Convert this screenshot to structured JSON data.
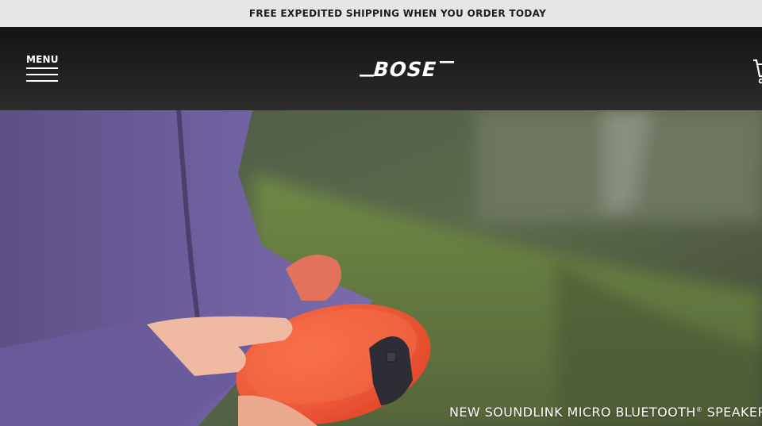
{
  "promo": {
    "text": "FREE EXPEDITED SHIPPING WHEN YOU ORDER TODAY"
  },
  "header": {
    "menu_label": "MENU",
    "logo_text": "BOSE",
    "icons": {
      "menu": "hamburger-icon",
      "cart": "cart-icon"
    }
  },
  "hero": {
    "caption_before": "NEW SOUNDLINK MICRO BLUETOOTH",
    "caption_reg": "®",
    "caption_after": " SPEAKER"
  },
  "colors": {
    "promo_bg": "#e6e6e6",
    "header_bg": "#1f1f1f",
    "sweater": "#6b5c96",
    "speaker": "#f15a38",
    "text_light": "#ffffff"
  }
}
